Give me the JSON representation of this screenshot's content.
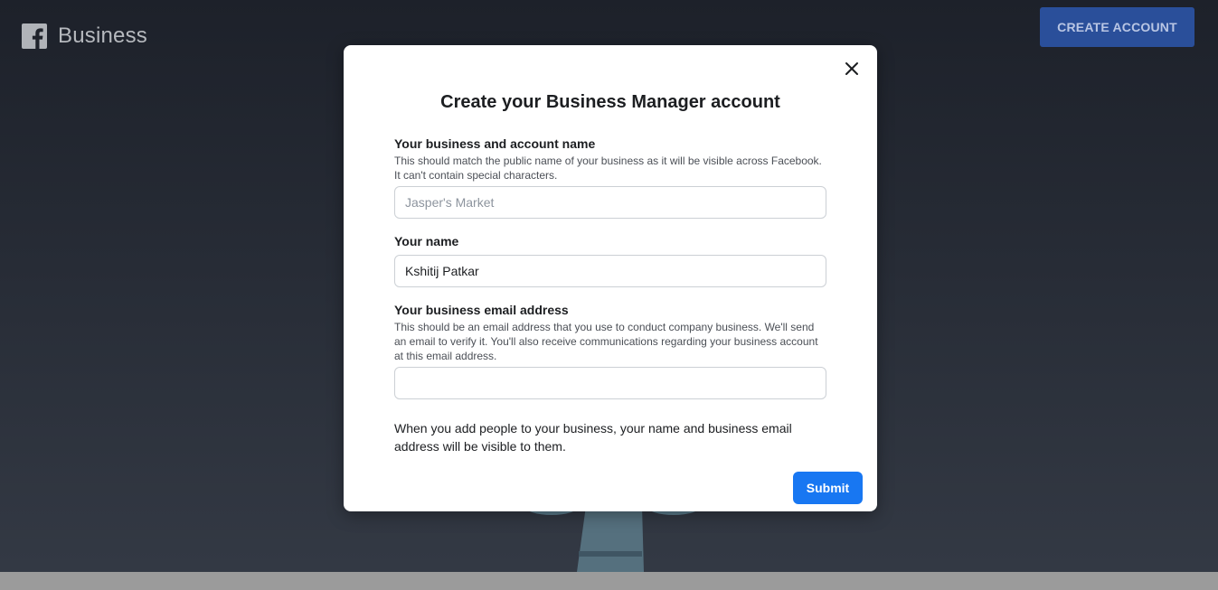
{
  "header": {
    "brand_text": "Business",
    "logo_icon": "facebook-logo-icon",
    "create_account_label": "CREATE ACCOUNT"
  },
  "modal": {
    "title": "Create your Business Manager account",
    "close_icon": "close-icon",
    "business_name": {
      "label": "Your business and account name",
      "help": "This should match the public name of your business as it will be visible across Facebook. It can't contain special characters.",
      "placeholder": "Jasper's Market",
      "value": ""
    },
    "your_name": {
      "label": "Your name",
      "value": "Kshitij Patkar"
    },
    "business_email": {
      "label": "Your business email address",
      "help": "This should be an email address that you use to conduct company business. We'll send an email to verify it. You'll also receive communications regarding your business account at this email address.",
      "value": ""
    },
    "notice": "When you add people to your business, your name and business email address will be visible to them.",
    "submit_label": "Submit"
  },
  "colors": {
    "primary_blue": "#1877f2",
    "header_button": "#2a4f9a",
    "background_dark": "#1d212a"
  }
}
